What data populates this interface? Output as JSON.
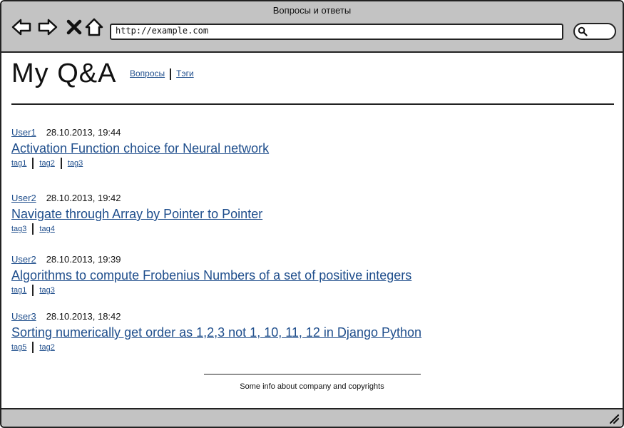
{
  "window": {
    "title": "Вопросы и ответы"
  },
  "browser": {
    "url": "http://example.com",
    "icons": [
      "back-arrow-icon",
      "forward-arrow-icon",
      "close-x-icon",
      "home-icon",
      "search-icon"
    ]
  },
  "header": {
    "title": "My Q&A",
    "nav": [
      "Вопросы",
      "Тэги"
    ]
  },
  "questions": [
    {
      "user": "User1",
      "date": "28.10.2013, 19:44",
      "title": "Activation Function choice for Neural network",
      "tags": [
        "tag1",
        "tag2",
        "tag3"
      ]
    },
    {
      "user": "User2",
      "date": "28.10.2013, 19:42",
      "title": "Navigate through Array by Pointer to Pointer",
      "tags": [
        "tag3",
        "tag4"
      ]
    },
    {
      "user": "User2",
      "date": "28.10.2013, 19:39",
      "title": "Algorithms to compute Frobenius Numbers of a set of positive integers",
      "tags": [
        "tag1",
        "tag3"
      ]
    },
    {
      "user": "User3",
      "date": "28.10.2013, 18:42",
      "title": "Sorting numerically get order as 1,2,3 not 1, 10, 11, 12 in Django Python",
      "tags": [
        "tag5",
        "tag2"
      ]
    }
  ],
  "footer": {
    "text": "Some info about company and copyrights"
  },
  "colors": {
    "chrome": "#c3c3c3",
    "link": "#1f4e8c",
    "border": "#222222"
  }
}
